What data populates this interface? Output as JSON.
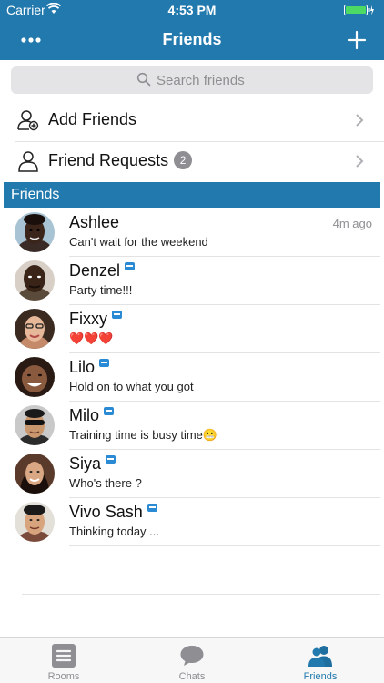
{
  "status_bar": {
    "carrier": "Carrier",
    "time": "4:53 PM"
  },
  "nav": {
    "title": "Friends",
    "menu_icon": "more-dots-icon",
    "add_icon": "plus-icon"
  },
  "search": {
    "placeholder": "Search friends"
  },
  "actions": [
    {
      "label": "Add Friends",
      "icon": "add-person-icon"
    },
    {
      "label": "Friend Requests",
      "icon": "person-icon",
      "badge": "2"
    }
  ],
  "section": {
    "title": "Friends"
  },
  "friends": [
    {
      "name": "Ashlee",
      "message": "Can't wait for the weekend",
      "time": "4m ago",
      "vip": false
    },
    {
      "name": "Denzel",
      "message": "Party time!!!",
      "time": "",
      "vip": true
    },
    {
      "name": "Fixxy",
      "message": "❤️❤️❤️",
      "time": "",
      "vip": true
    },
    {
      "name": "Lilo",
      "message": "Hold on to what you got",
      "time": "",
      "vip": true
    },
    {
      "name": "Milo",
      "message": "Training time is busy time😬",
      "time": "",
      "vip": true
    },
    {
      "name": "Siya",
      "message": "Who's there ?",
      "time": "",
      "vip": true
    },
    {
      "name": "Vivo Sash",
      "message": "Thinking today ...",
      "time": "",
      "vip": true
    }
  ],
  "tabs": [
    {
      "label": "Rooms",
      "icon": "rooms-icon",
      "active": false
    },
    {
      "label": "Chats",
      "icon": "chat-bubble-icon",
      "active": false
    },
    {
      "label": "Friends",
      "icon": "friends-icon",
      "active": true
    }
  ],
  "colors": {
    "brand": "#2279ad",
    "separator": "#e3e3e3",
    "muted": "#8e8e93"
  }
}
